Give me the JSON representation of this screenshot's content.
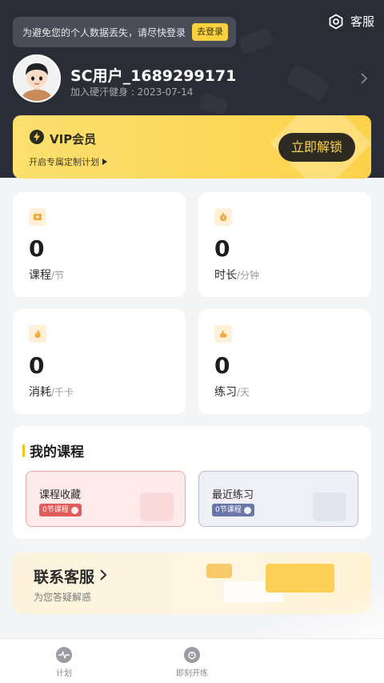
{
  "header": {
    "login_tip": "为避免您的个人数据丢失，请尽快登录",
    "login_button": "去登录",
    "service_label": "客服"
  },
  "user": {
    "name": "SC用户_1689299171",
    "join_date": "加入硬汗健身 : 2023-07-14"
  },
  "vip": {
    "title": "VIP会员",
    "subtitle": "开启专属定制计划",
    "button": "立即解锁"
  },
  "stats": [
    {
      "value": "0",
      "label": "课程",
      "unit": "/节",
      "icon": "course-icon"
    },
    {
      "value": "0",
      "label": "时长",
      "unit": "/分钟",
      "icon": "stopwatch-icon"
    },
    {
      "value": "0",
      "label": "消耗",
      "unit": "/千卡",
      "icon": "flame-icon"
    },
    {
      "value": "0",
      "label": "练习",
      "unit": "/天",
      "icon": "muscle-icon"
    }
  ],
  "my_courses": {
    "title": "我的课程",
    "favorites": {
      "title": "课程收藏",
      "badge": "0节课程"
    },
    "recent": {
      "title": "最近练习",
      "badge": "0节课程"
    }
  },
  "contact": {
    "title": "联系客服",
    "subtitle": "为您答疑解惑"
  },
  "tabbar": {
    "items": [
      {
        "label": "计划",
        "icon": "pulse-icon"
      },
      {
        "label": "即刻开练",
        "icon": "timer-icon"
      }
    ]
  },
  "colors": {
    "header_bg": "#2a2d36",
    "accent_yellow": "#fcd24a",
    "favorites_red": "#e25b5b",
    "recent_blue": "#6a76a6"
  }
}
